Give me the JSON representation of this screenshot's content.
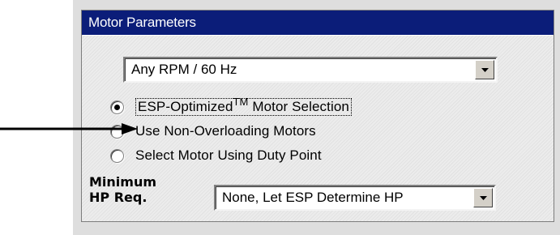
{
  "panel": {
    "title": "Motor Parameters"
  },
  "speed_select": {
    "value": "Any RPM / 60 Hz"
  },
  "motor_selection": {
    "options": [
      {
        "label": "ESP-Optimized",
        "superscript": "TM",
        "label_suffix": " Motor Selection",
        "checked": true
      },
      {
        "label": "Use Non-Overloading Motors",
        "checked": false
      },
      {
        "label": "Select Motor Using Duty Point",
        "checked": false
      }
    ]
  },
  "min_hp": {
    "label_line1": "Minimum",
    "label_line2": "HP Req.",
    "value": "None, Let ESP Determine HP"
  },
  "colors": {
    "title_bar": "#0b1d79",
    "title_text": "#ffffff",
    "panel_bg": "#ececec",
    "arrow": "#000000"
  },
  "icons": {
    "dropdown": "chevron-down-icon",
    "pointer": "arrow-right-icon"
  }
}
